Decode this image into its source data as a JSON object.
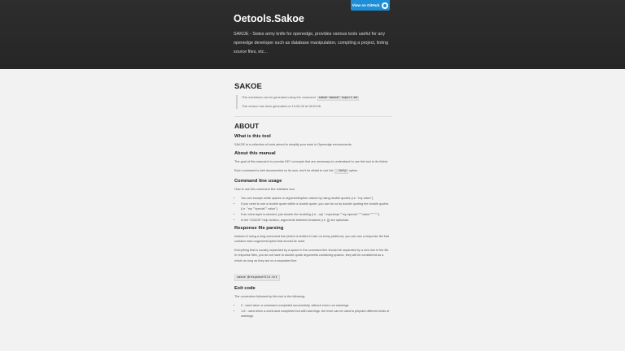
{
  "header": {
    "github_button": "View on GitHub",
    "title": "Oetools.Sakoe",
    "description": "SAKOE - Swiss army knife for openedge, provides various tools useful for any openedge developer such as database manipulation, compiling a project, linting source files, etc..."
  },
  "doc": {
    "title": "SAKOE",
    "notes": {
      "generated_pre": "This markdown can be generated using the command:",
      "generated_cmd": "sakoe manual export-md",
      "version_text": "This version has been generated on 19-06-26 at 18:50:06."
    },
    "about_heading": "ABOUT",
    "what_heading": "What is this tool",
    "what_text": "SAKOE is a collection of tools aimed to simplify your work in Openedge environments.",
    "manual_heading": "About this manual",
    "manual_text1": "The goal of this manual is to provide KEY concepts that are necessary to understand to use this tool to its fullest.",
    "manual_text2_pre": "Each command is well documented on its own, don't be afraid to use the",
    "manual_text2_code": "--help",
    "manual_text2_post": "option.",
    "cli_heading": "Command line usage",
    "cli_intro": "How to use this command line interface tool:",
    "cli_items": [
      "You can escape white spaces in argument/option values by using double quotes (i.e. \"my value\").",
      "If you need to use a double quote within a double quote, you can do so by double quoting the double quotes (i.e. \"my \"\"special\"\" value\").",
      "If an extra layer is needed, just double the doubling (i.e. -opt \"-mysubopt \"\"my special \"\"\"\"value\"\"\"\"\"\"\"\").",
      "In the 'USAGE' help section, arguments between brackets (i.e. []) are optionals."
    ],
    "response_heading": "Response file parsing",
    "response_text1": "Instead of using a long command line (which is limited in size on every platform), you can use a response file that contains each argument/option that should be used.",
    "response_text2": "Everything that is usually separated by a space in the command line should be separated by a new line in the file. In response files, you do not have to double quote arguments containing spaces, they will be considered as a whole as long as they are on a separated line.",
    "response_code": "sakoe @responsefile.txt",
    "exit_heading": "Exit code",
    "exit_intro": "The convention followed by this tool is the following.",
    "exit_items": [
      "0 : used when a command completed successfully, without errors nor warnings.",
      "1-8 : used when a command completed but with warnings, the level can be used to pinpoint different kinds of warnings."
    ]
  },
  "colors": {
    "header_bg": "#2b2b2b",
    "button": "#1e8fd6",
    "page_bg": "#f2f2f2"
  }
}
